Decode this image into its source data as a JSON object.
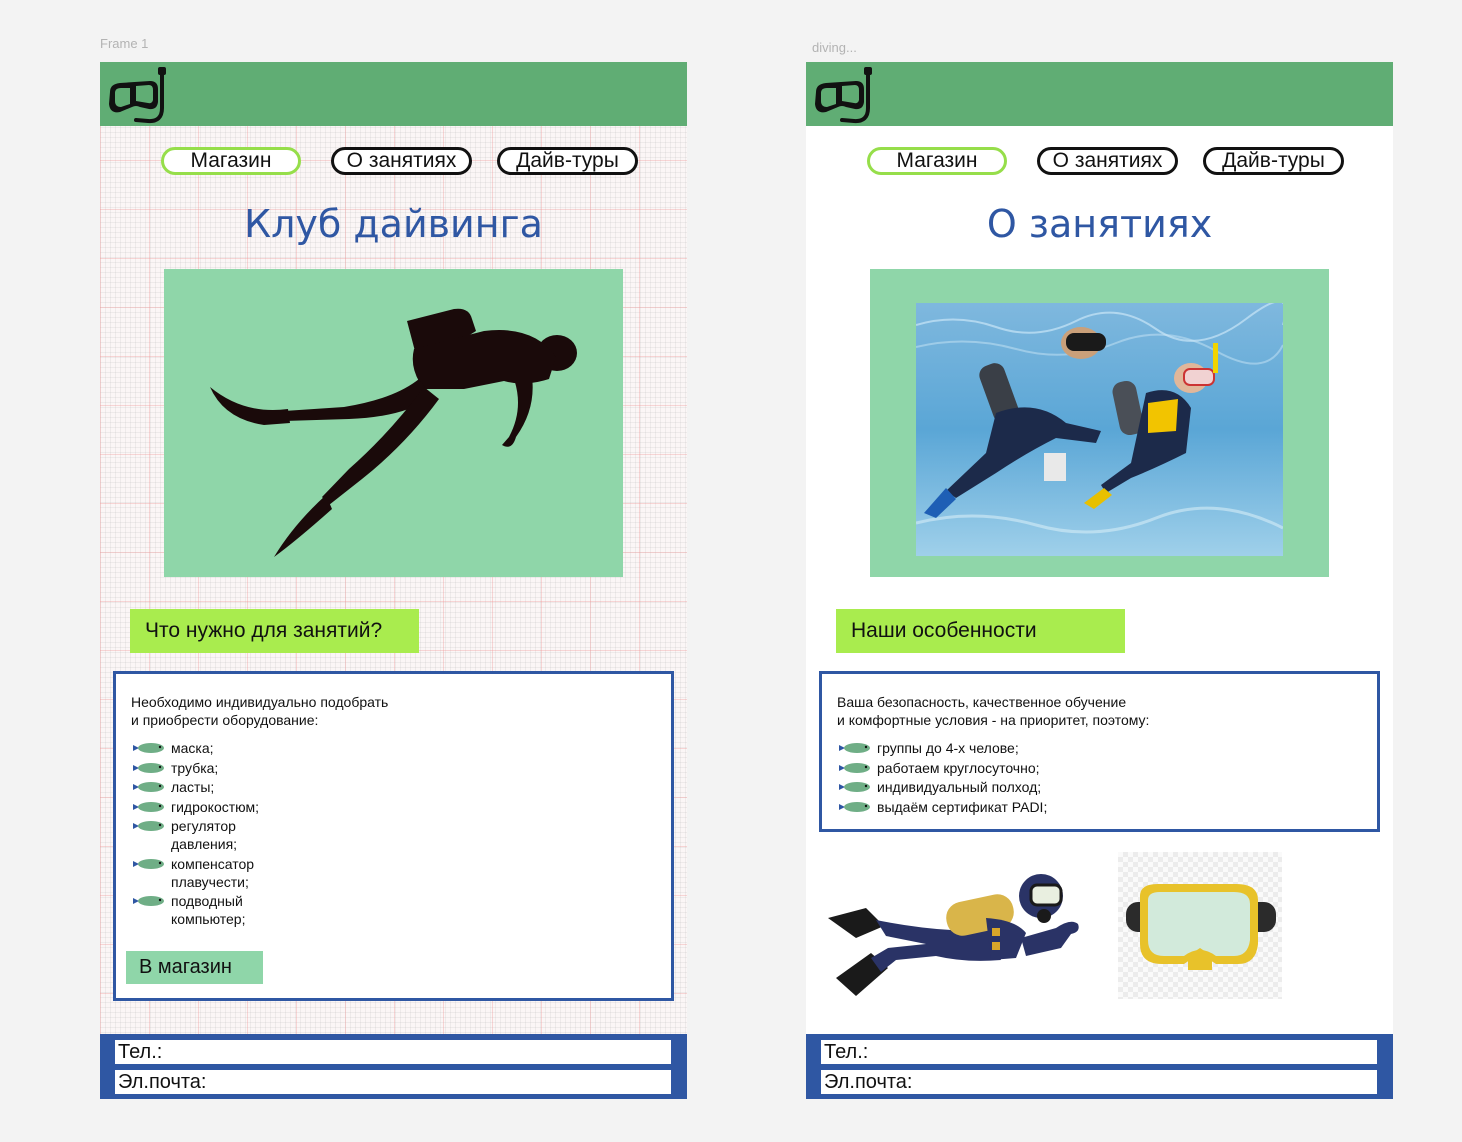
{
  "frames": [
    {
      "label": "Frame 1",
      "nav": [
        "Магазин",
        "О занятиях",
        "Дайв-туры"
      ],
      "title": "Клуб дайвинга",
      "hero_image": "diver-silhouette",
      "section_label": "Что нужно для занятий?",
      "intro": "Необходимо индивидуально подобрать\nи приобрести оборудование:",
      "items": [
        "маска;",
        "трубка;",
        "ласты;",
        "гидрокостюм;",
        "регулятор\nдавления;",
        "компенсатор\nплавучести;",
        "подводный\nкомпьютер;"
      ],
      "button": "В магазин",
      "footer": {
        "phone": "Тел.:",
        "email": "Эл.почта:"
      }
    },
    {
      "label": "diving...",
      "nav": [
        "Магазин",
        "О занятиях",
        "Дайв-туры"
      ],
      "title": "О занятиях",
      "hero_image": "divers-underwater-photo",
      "section_label": "Наши особенности",
      "intro": "Ваша безопасность, качественное обучение\nи комфортные условия - на приоритет, поэтому:",
      "items": [
        "группы до 4-х челове;",
        "работаем круглосуточно;",
        "индивидуальный полход;",
        "выдаём сертификат PADI;"
      ],
      "illustrations": [
        "scuba-diver-illustration",
        "diving-mask-image"
      ],
      "footer": {
        "phone": "Тел.:",
        "email": "Эл.почта:"
      }
    }
  ],
  "icons": {
    "logo": "snorkel-mask-icon",
    "bullet": "fish-icon"
  },
  "colors": {
    "header": "#60ad74",
    "hero_bg": "#8fd6a9",
    "section_label": "#a9ec4e",
    "title": "#2f57a3",
    "footer": "#2f57a3",
    "nav_highlight": "#96de4a"
  }
}
